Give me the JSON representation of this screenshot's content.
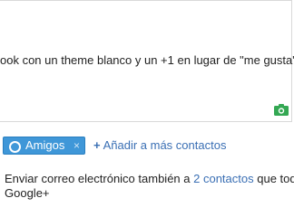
{
  "compose": {
    "text": "ook con un theme blanco y un +1 en lugar de \"me gusta\"",
    "camera_icon": "camera-icon",
    "accent_color": "#34a853"
  },
  "share": {
    "chip_label": "Amigos",
    "chip_remove": "×",
    "chip_icon": "circle-icon",
    "chip_color": "#3f97d8",
    "add_more_plus": "+",
    "add_more_label": "Añadir a más contactos"
  },
  "notice": {
    "prefix": "Enviar correo electrónico también a",
    "link": "2 contactos",
    "suffix": "que tod",
    "line2": "Google+"
  }
}
